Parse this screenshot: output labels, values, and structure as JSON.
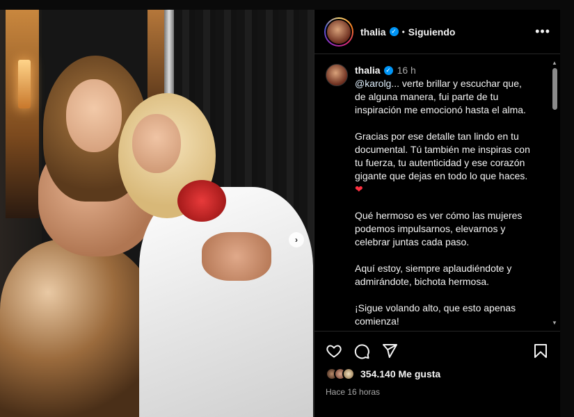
{
  "post": {
    "username": "thalia",
    "follow_status": "Siguiendo",
    "separator": "•",
    "verified": true
  },
  "caption": {
    "username": "thalia",
    "time": "16 h",
    "mention": "@karolg",
    "paragraphs": [
      "... verte brillar y escuchar que, de alguna manera, fui parte de tu inspiración me emocionó hasta el alma.",
      "Gracias por ese detalle tan lindo en tu documental. Tú también me inspiras con tu fuerza, tu autenticidad y ese corazón gigante que dejas en todo lo que haces.",
      "Qué hermoso es ver cómo las mujeres podemos impulsarnos, elevarnos y celebrar juntas cada paso.",
      "Aquí estoy, siempre aplaudiéndote y admirándote, bichota hermosa.",
      "¡Sigue volando alto, que esto apenas comienza!"
    ],
    "heart": "❤"
  },
  "stats": {
    "likes": "354.140 Me gusta",
    "time_ago": "Hace 16 horas"
  },
  "icons": {
    "verified": "verified-badge-icon",
    "more": "more-options-icon",
    "like": "heart-icon",
    "comment": "comment-icon",
    "share": "share-icon",
    "save": "bookmark-icon",
    "next": "chevron-right-icon"
  },
  "colors": {
    "background": "#000000",
    "verified": "#0095f6",
    "heart": "#ff3040",
    "muted_text": "#a8a8a8"
  }
}
